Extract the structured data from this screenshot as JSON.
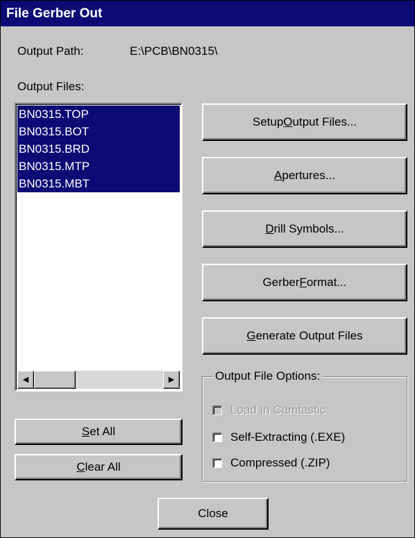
{
  "window": {
    "title": "File Gerber Out"
  },
  "output_path": {
    "label": "Output Path:",
    "value": "E:\\PCB\\BN0315\\"
  },
  "output_files": {
    "label": "Output Files:",
    "items": [
      "BN0315.TOP",
      "BN0315.BOT",
      "BN0315.BRD",
      "BN0315.MTP",
      "BN0315.MBT"
    ]
  },
  "scrollbar": {
    "left_arrow": "◀",
    "right_arrow": "▶"
  },
  "buttons": {
    "setup_output_files": {
      "pre": "Setup ",
      "key": "O",
      "post": "utput Files..."
    },
    "apertures": {
      "pre": "",
      "key": "A",
      "post": "pertures..."
    },
    "drill_symbols": {
      "pre": "",
      "key": "D",
      "post": "rill Symbols..."
    },
    "gerber_format": {
      "pre": "Gerber ",
      "key": "F",
      "post": "ormat..."
    },
    "generate_output_files": {
      "pre": "",
      "key": "G",
      "post": "enerate Output Files"
    },
    "set_all": {
      "pre": "",
      "key": "S",
      "post": "et All"
    },
    "clear_all": {
      "pre": "",
      "key": "C",
      "post": "lear All"
    },
    "close": {
      "label": "Close"
    }
  },
  "options": {
    "title": "Output File Options:",
    "load_in_camtastic": {
      "label": "Load In Camtastic",
      "checked": false,
      "enabled": false
    },
    "self_extracting": {
      "label": "Self-Extracting (.EXE)",
      "checked": false,
      "enabled": true
    },
    "compressed": {
      "label": "Compressed (.ZIP)",
      "checked": false,
      "enabled": true
    }
  },
  "colors": {
    "title_bar": "#0c0a74",
    "selection": "#0c0a74",
    "dialog_bg": "#c6c6c6"
  }
}
